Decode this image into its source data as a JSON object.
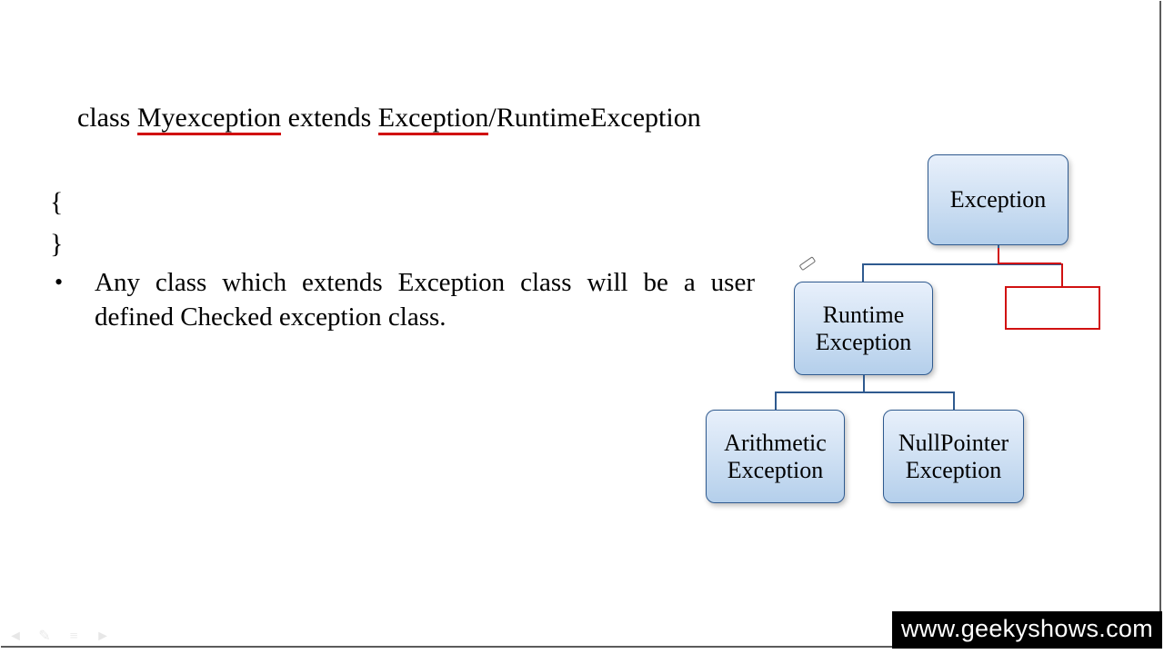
{
  "code": {
    "line1_parts": {
      "p1": "class ",
      "p2": "Myexception",
      "p3": " extends ",
      "p4": "Exception",
      "p5": "/RuntimeException"
    },
    "line2": "{",
    "line3": "",
    "line4": "}"
  },
  "bullet": {
    "text": "Any class which extends Exception class will be a user defined Checked exception class."
  },
  "diagram": {
    "nodes": {
      "exception": "Exception",
      "runtime": "Runtime\nException",
      "arithmetic": "Arithmetic\nException",
      "nullpointer": "NullPointer\nException"
    }
  },
  "footer": {
    "url": "www.geekyshows.com"
  },
  "nav": {
    "back": "◄",
    "pen": "✎",
    "menu": "≡",
    "fwd": "►"
  }
}
